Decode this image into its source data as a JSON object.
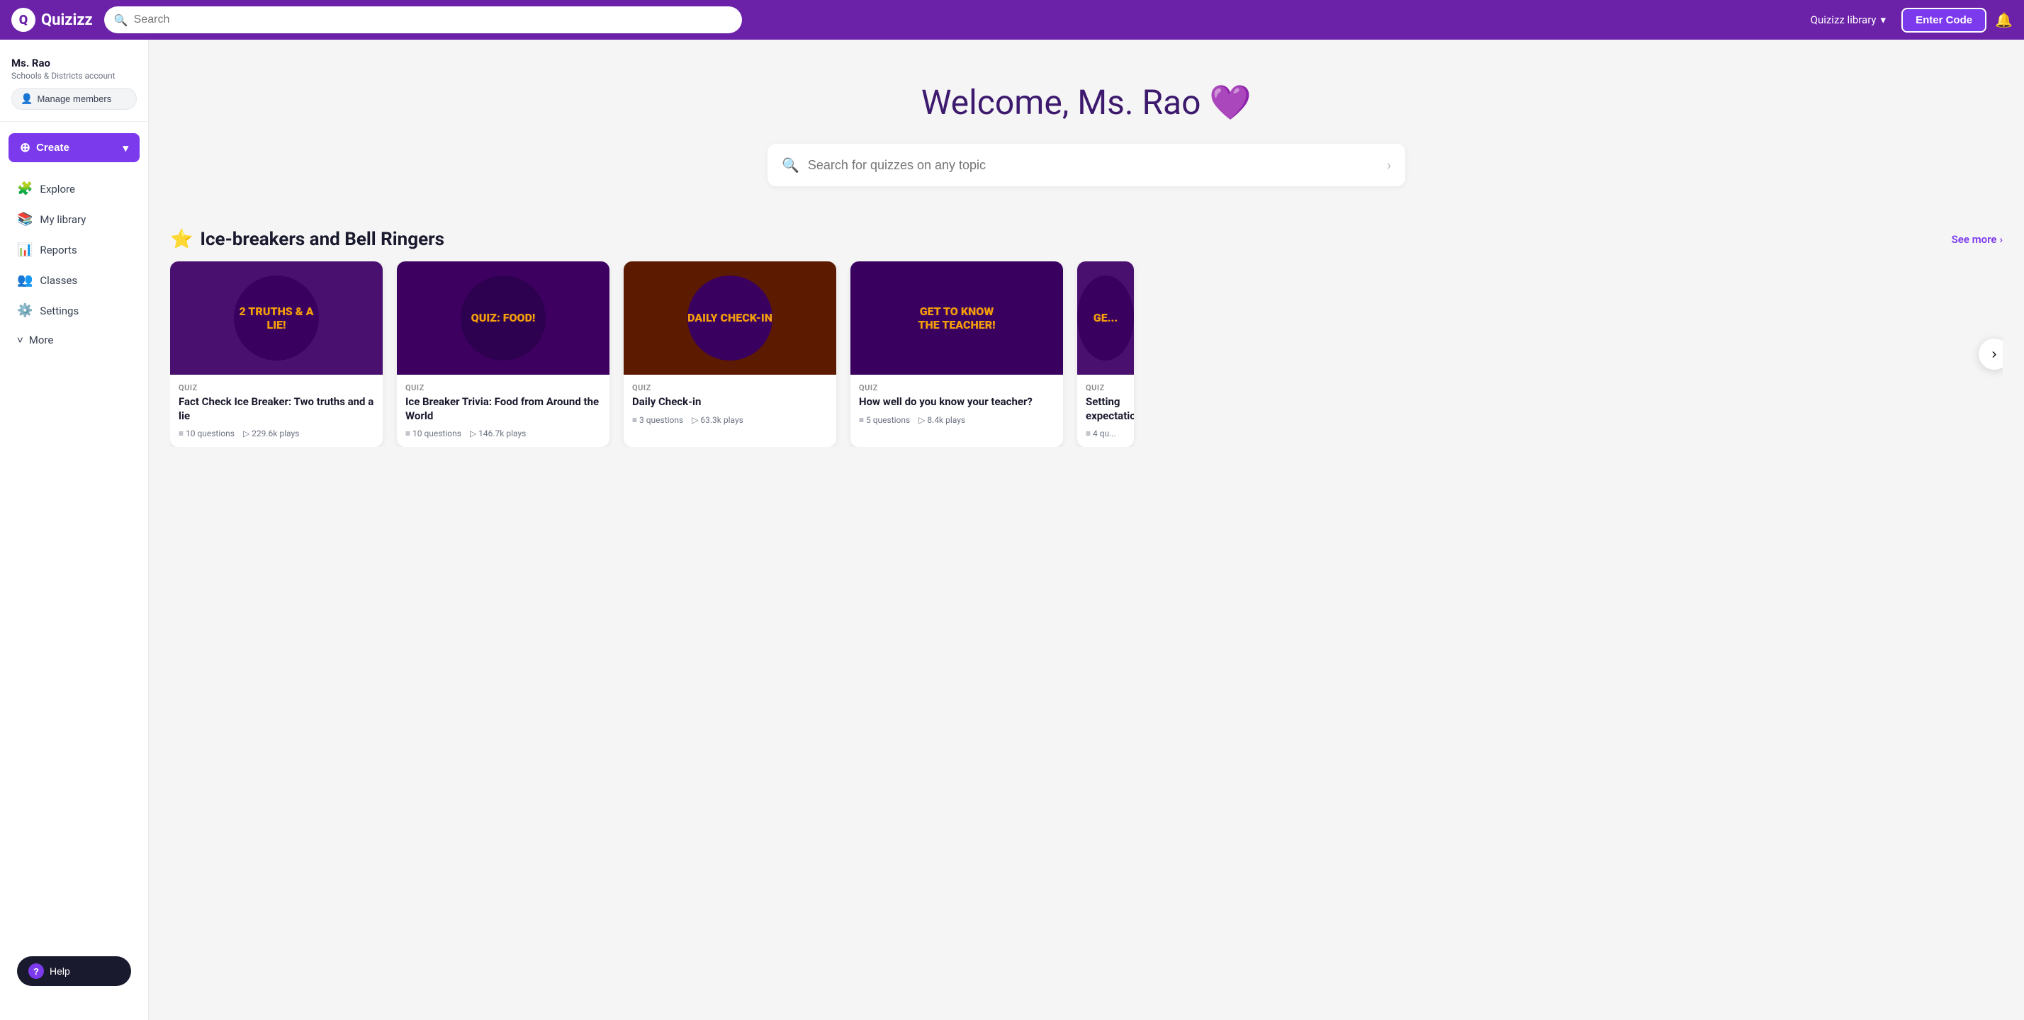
{
  "nav": {
    "logo_text": "Quizizz",
    "search_placeholder": "Search",
    "library_label": "Quizizz library",
    "enter_code_label": "Enter Code",
    "notification_icon": "bell"
  },
  "sidebar": {
    "user_name": "Ms. Rao",
    "user_account": "Schools & Districts account",
    "manage_members_label": "Manage members",
    "create_label": "Create",
    "nav_items": [
      {
        "id": "explore",
        "label": "Explore",
        "icon": "🧩"
      },
      {
        "id": "my-library",
        "label": "My library",
        "icon": "📚"
      },
      {
        "id": "reports",
        "label": "Reports",
        "icon": "📊"
      },
      {
        "id": "classes",
        "label": "Classes",
        "icon": "👥"
      },
      {
        "id": "settings",
        "label": "Settings",
        "icon": "⚙️"
      }
    ],
    "more_label": "More",
    "help_label": "Help"
  },
  "hero": {
    "title_prefix": "Welcome, Ms. Rao",
    "title_heart": "💜",
    "search_placeholder": "Search for quizzes on any topic"
  },
  "section1": {
    "title": "Ice-breakers and Bell Ringers",
    "star_icon": "⭐",
    "see_more_label": "See more",
    "cards": [
      {
        "type": "QUIZ",
        "title": "Fact Check Ice Breaker: Two truths and a lie",
        "image_text": "2 truths & a lie!",
        "questions": "10 questions",
        "plays": "229.6k plays"
      },
      {
        "type": "QUIZ",
        "title": "Ice Breaker Trivia: Food from Around the World",
        "image_text": "QUIZ: Food!",
        "questions": "10 questions",
        "plays": "146.7k plays"
      },
      {
        "type": "QUIZ",
        "title": "Daily Check-in",
        "image_text": "Daily check-in",
        "questions": "3 questions",
        "plays": "63.3k plays"
      },
      {
        "type": "QUIZ",
        "title": "How well do you know your teacher?",
        "image_text": "Get to know THE TEACHER!",
        "questions": "5 questions",
        "plays": "8.4k plays"
      },
      {
        "type": "QUIZ",
        "title": "Setting expectations...",
        "image_text": "Ge...",
        "questions": "4 qu...",
        "plays": ""
      }
    ]
  }
}
